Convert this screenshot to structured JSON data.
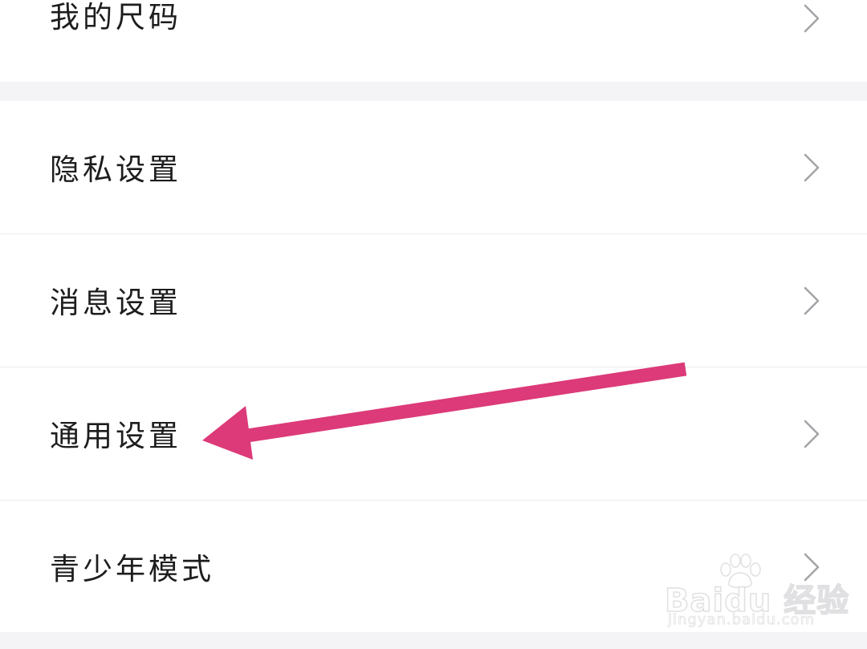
{
  "items_top": [
    {
      "label": "我的尺码"
    }
  ],
  "items_main": [
    {
      "label": "隐私设置"
    },
    {
      "label": "消息设置"
    },
    {
      "label": "通用设置"
    },
    {
      "label": "青少年模式"
    }
  ],
  "annotation": {
    "arrow_color": "#dc3a78"
  },
  "watermark": {
    "brand": "Baidu 经验",
    "url": "jingyan.baidu.com"
  },
  "icons": {
    "row_chevron": "chevron-right-icon"
  }
}
